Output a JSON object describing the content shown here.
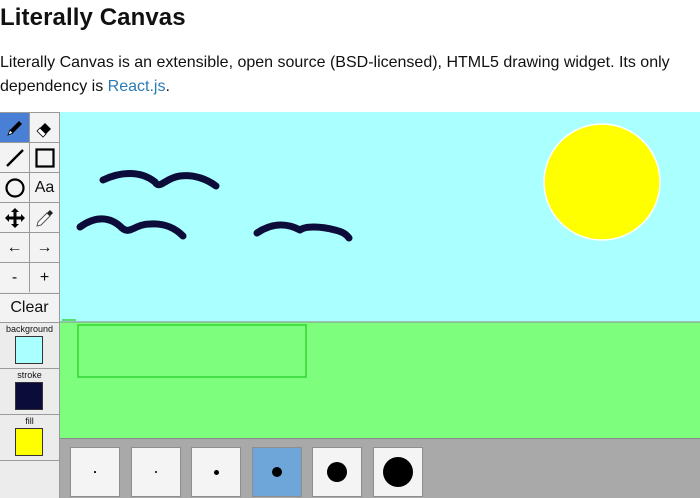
{
  "page": {
    "title": "Literally Canvas",
    "intro_text": "Literally Canvas is an extensible, open source (BSD-licensed), HTML5 drawing widget. Its only dependency is ",
    "intro_link": "React.js",
    "intro_end": "."
  },
  "toolbar": {
    "tools": [
      {
        "name": "pencil",
        "icon": "pencil-icon",
        "selected": true
      },
      {
        "name": "eraser",
        "icon": "eraser-icon"
      },
      {
        "name": "line",
        "icon": "line-icon"
      },
      {
        "name": "rectangle",
        "icon": "rectangle-icon"
      },
      {
        "name": "ellipse",
        "icon": "ellipse-icon"
      },
      {
        "name": "text",
        "icon": "text-icon",
        "label": "Aa"
      },
      {
        "name": "pan",
        "icon": "move-icon"
      },
      {
        "name": "eyedropper",
        "icon": "eyedropper-icon"
      },
      {
        "name": "undo",
        "label": "←"
      },
      {
        "name": "redo",
        "label": "→"
      },
      {
        "name": "zoom-out",
        "label": "-"
      },
      {
        "name": "zoom-in",
        "label": "+"
      }
    ],
    "clear_label": "Clear",
    "colors": {
      "background_label": "background",
      "background": "#aaffff",
      "stroke_label": "stroke",
      "stroke": "#0c0c3a",
      "fill_label": "fill",
      "fill": "#ffff00"
    }
  },
  "canvas": {
    "sky_color": "#aaffff",
    "grass_color": "#7dff7d",
    "sun_color": "#ffff00",
    "bird_color": "#0c0c3a",
    "rect_outline_color": "#2fd22f"
  },
  "stroke_widths": {
    "options": [
      1,
      2,
      5,
      10,
      20,
      30
    ],
    "selected": 10
  }
}
